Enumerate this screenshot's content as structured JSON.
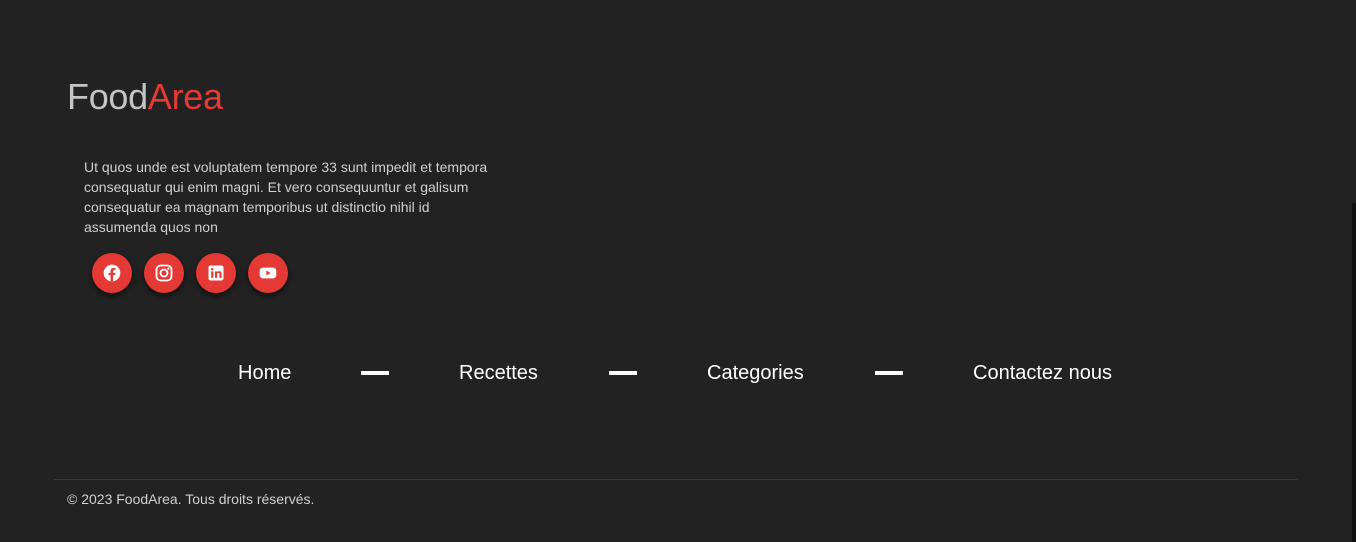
{
  "brand": {
    "part1": "Food",
    "part2": "Area",
    "color1": "#c4c4c4",
    "color2": "#e53935"
  },
  "description": "Ut quos unde est voluptatem tempore 33 sunt impedit et tempora consequatur qui enim magni. Et vero consequuntur et galisum consequatur ea magnam temporibus ut distinctio nihil id assumenda quos non",
  "socials": [
    {
      "icon": "facebook-icon"
    },
    {
      "icon": "instagram-icon"
    },
    {
      "icon": "linkedin-icon"
    },
    {
      "icon": "youtube-icon"
    }
  ],
  "nav": {
    "home": "Home",
    "recettes": "Recettes",
    "categories": "Categories",
    "contact": "Contactez nous"
  },
  "copyright": "© 2023 FoodArea. Tous droits réservés.",
  "colors": {
    "background": "#222222",
    "accent": "#e53935",
    "text": "#ffffff"
  }
}
